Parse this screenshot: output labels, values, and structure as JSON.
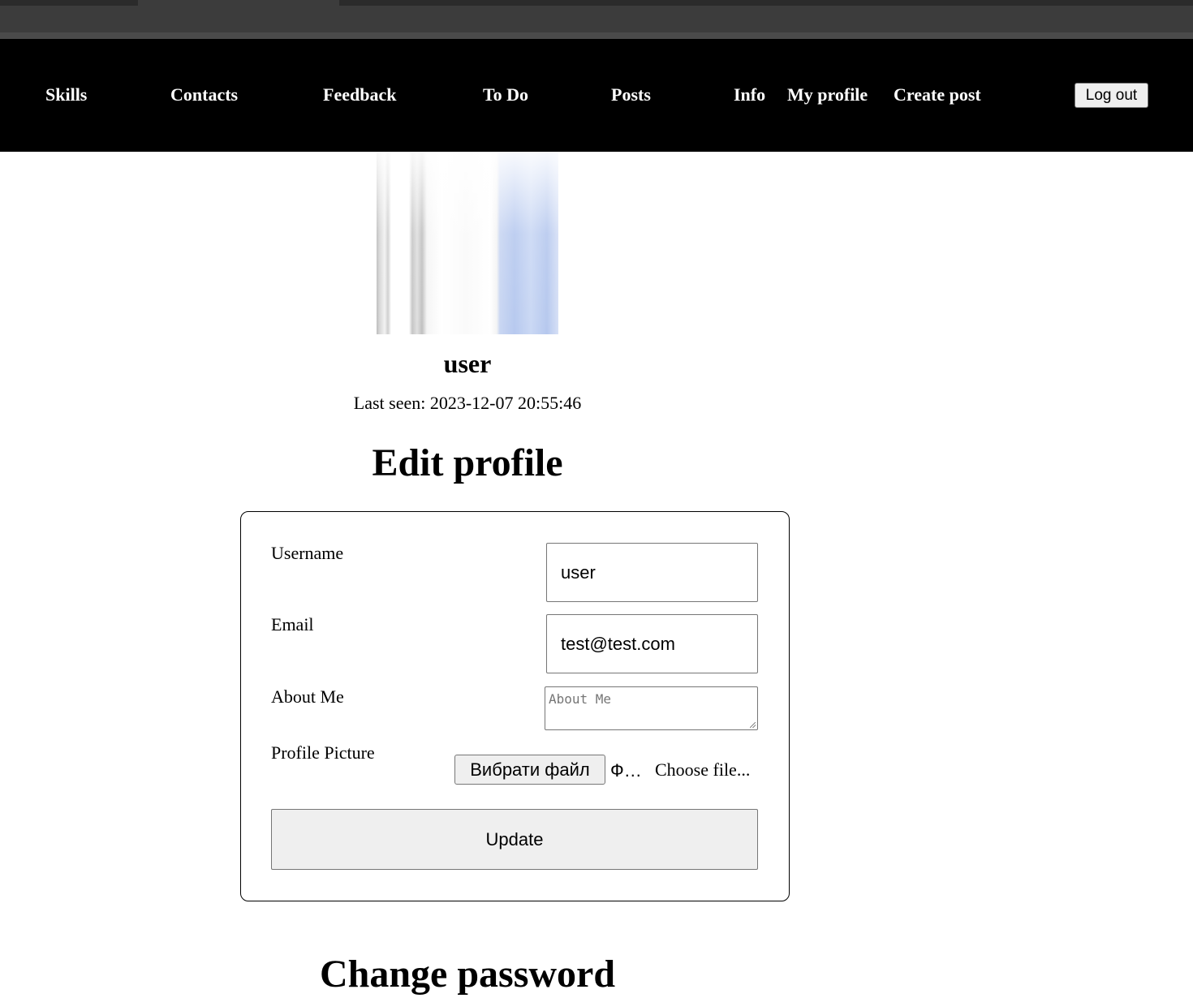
{
  "navbar": {
    "links": [
      {
        "label": "Skills"
      },
      {
        "label": "Contacts"
      },
      {
        "label": "Feedback"
      },
      {
        "label": "To Do"
      },
      {
        "label": "Posts"
      },
      {
        "label": "Info"
      },
      {
        "label": "My profile"
      },
      {
        "label": "Create post"
      }
    ],
    "logout_label": "Log out"
  },
  "profile": {
    "username": "user",
    "last_seen": "Last seen: 2023-12-07 20:55:46"
  },
  "edit_form": {
    "title": "Edit profile",
    "username_label": "Username",
    "username_value": "user",
    "email_label": "Email",
    "email_value": "test@test.com",
    "about_label": "About Me",
    "about_placeholder": "About Me",
    "picture_label": "Profile Picture",
    "file_button_label": "Вибрати файл",
    "file_status": "Ф…",
    "file_hint": "Choose file...",
    "submit_label": "Update"
  },
  "change_password": {
    "title": "Change password"
  }
}
